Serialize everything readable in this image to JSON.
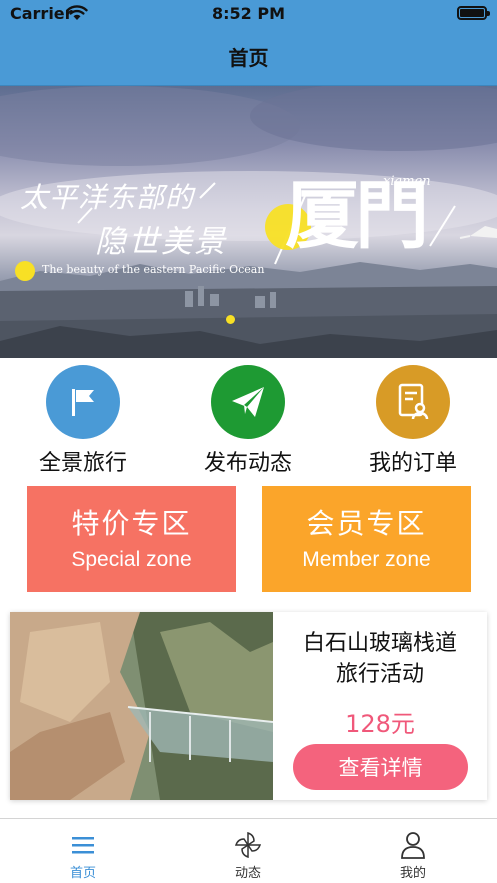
{
  "status_bar": {
    "carrier": "Carrier",
    "time": "8:52 PM"
  },
  "nav": {
    "title": "首页"
  },
  "banner": {
    "line1": "太平洋东部的",
    "line2": "隐世美景",
    "big_text": "厦門",
    "small_text": "xiamen",
    "subtitle": "The beauty of the eastern Pacific Ocean"
  },
  "quick_links": [
    {
      "label": "全景旅行",
      "icon": "flag-icon",
      "color": "#4a9ad6"
    },
    {
      "label": "发布动态",
      "icon": "paper-plane-icon",
      "color": "#1e9a33"
    },
    {
      "label": "我的订单",
      "icon": "order-document-icon",
      "color": "#d89b26"
    }
  ],
  "promos": [
    {
      "title": "特价专区",
      "subtitle": "Special zone",
      "color": "#f67263"
    },
    {
      "title": "会员专区",
      "subtitle": "Member zone",
      "color": "#fba52a"
    }
  ],
  "product": {
    "title": "白石山玻璃栈道旅行活动",
    "price": "128元",
    "button": "查看详情",
    "accent": "#f4637d"
  },
  "tabs": [
    {
      "label": "首页",
      "icon": "home-list-icon",
      "active": true
    },
    {
      "label": "动态",
      "icon": "pinwheel-icon",
      "active": false
    },
    {
      "label": "我的",
      "icon": "person-icon",
      "active": false
    }
  ],
  "colors": {
    "nav": "#4a9ad6",
    "tab_active": "#3b8fd6",
    "tab_inactive": "#333333"
  }
}
